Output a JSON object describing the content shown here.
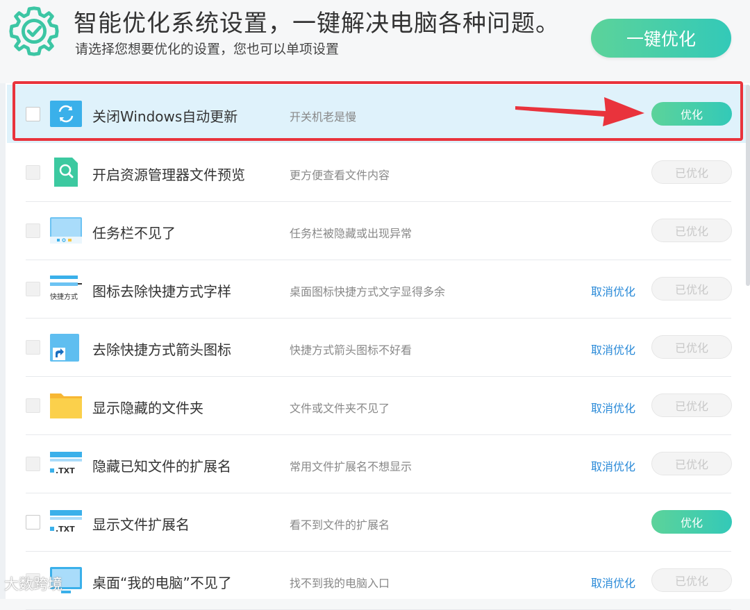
{
  "header": {
    "title": "智能优化系统设置，一键解决电脑各种问题。",
    "subtitle": "请选择您想要优化的设置，您也可以单项设置",
    "one_key_button": "一键优化",
    "gear_icon": "gear-check-icon"
  },
  "items": [
    {
      "name": "关闭Windows自动更新",
      "desc": "开关机老是慢",
      "cancel": "",
      "button": "优化",
      "state": "active",
      "icon": "windows-update-icon"
    },
    {
      "name": "开启资源管理器文件预览",
      "desc": "更方便查看文件内容",
      "cancel": "",
      "button": "已优化",
      "state": "done",
      "icon": "file-search-icon"
    },
    {
      "name": "任务栏不见了",
      "desc": "任务栏被隐藏或出现异常",
      "cancel": "",
      "button": "已优化",
      "state": "done",
      "icon": "taskbar-window-icon"
    },
    {
      "name": "图标去除快捷方式字样",
      "desc": "桌面图标快捷方式文字显得多余",
      "cancel": "取消优化",
      "button": "已优化",
      "state": "done",
      "icon": "shortcut-text-icon",
      "icon_label": "快捷方式"
    },
    {
      "name": "去除快捷方式箭头图标",
      "desc": "快捷方式箭头图标不好看",
      "cancel": "取消优化",
      "button": "已优化",
      "state": "done",
      "icon": "shortcut-arrow-icon"
    },
    {
      "name": "显示隐藏的文件夹",
      "desc": "文件或文件夹不见了",
      "cancel": "取消优化",
      "button": "已优化",
      "state": "done",
      "icon": "folder-icon"
    },
    {
      "name": "隐藏已知文件的扩展名",
      "desc": "常用文件扩展名不想显示",
      "cancel": "取消优化",
      "button": "已优化",
      "state": "done",
      "icon": "txt-extension-icon",
      "icon_label": ".TXT"
    },
    {
      "name": "显示文件扩展名",
      "desc": "看不到文件的扩展名",
      "cancel": "",
      "button": "优化",
      "state": "active",
      "icon": "txt-extension-icon",
      "icon_label": ".TXT"
    },
    {
      "name": "桌面“我的电脑”不见了",
      "desc": "找不到我的电脑入口",
      "cancel": "取消优化",
      "button": "已优化",
      "state": "done",
      "icon": "monitor-icon"
    }
  ],
  "watermark": "大数跨境",
  "colors": {
    "accent_green": "#4ccfa6",
    "link_blue": "#2a8ad8",
    "highlight": "#dff2fb",
    "annotation_red": "#e9333c"
  }
}
